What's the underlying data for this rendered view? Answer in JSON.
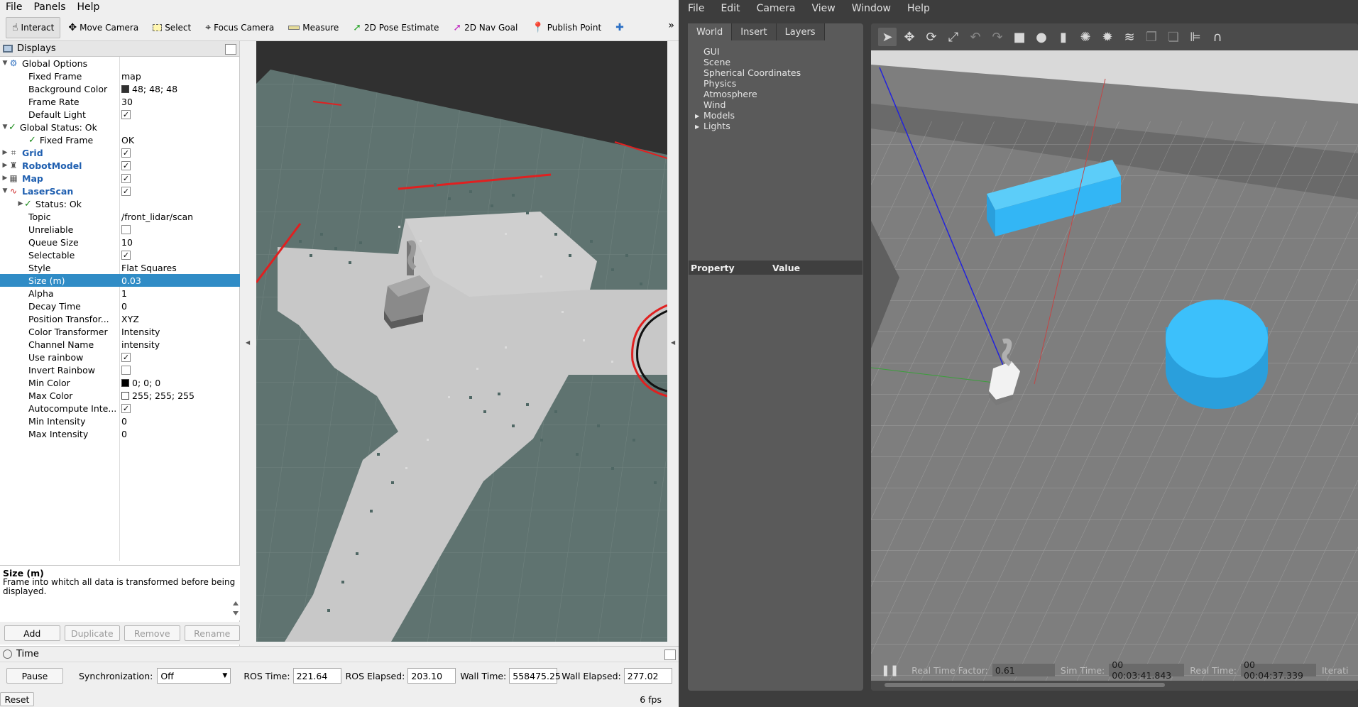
{
  "rviz": {
    "menu": [
      "File",
      "Panels",
      "Help"
    ],
    "tools": [
      {
        "label": "Interact",
        "icon": "interact-icon"
      },
      {
        "label": "Move Camera",
        "icon": "move-camera-icon"
      },
      {
        "label": "Select",
        "icon": "select-icon"
      },
      {
        "label": "Focus Camera",
        "icon": "focus-camera-icon"
      },
      {
        "label": "Measure",
        "icon": "measure-icon"
      },
      {
        "label": "2D Pose Estimate",
        "icon": "pose-estimate-icon"
      },
      {
        "label": "2D Nav Goal",
        "icon": "nav-goal-icon"
      },
      {
        "label": "Publish Point",
        "icon": "publish-point-icon"
      }
    ],
    "displays_title": "Displays",
    "tree": {
      "global_options": "Global Options",
      "fixed_frame_label": "Fixed Frame",
      "fixed_frame_value": "map",
      "background_color_label": "Background Color",
      "background_color_value": "48; 48; 48",
      "frame_rate_label": "Frame Rate",
      "frame_rate_value": "30",
      "default_light_label": "Default Light",
      "global_status": "Global Status: Ok",
      "fixed_frame_status_label": "Fixed Frame",
      "fixed_frame_status_value": "OK",
      "grid": "Grid",
      "robot_model": "RobotModel",
      "map": "Map",
      "laser_scan": "LaserScan",
      "status_ok": "Status: Ok",
      "topic_label": "Topic",
      "topic_value": "/front_lidar/scan",
      "unreliable_label": "Unreliable",
      "queue_size_label": "Queue Size",
      "queue_size_value": "10",
      "selectable_label": "Selectable",
      "style_label": "Style",
      "style_value": "Flat Squares",
      "size_label": "Size (m)",
      "size_value": "0.03",
      "alpha_label": "Alpha",
      "alpha_value": "1",
      "decay_label": "Decay Time",
      "decay_value": "0",
      "position_transformer_label": "Position Transfor...",
      "position_transformer_value": "XYZ",
      "color_transformer_label": "Color Transformer",
      "color_transformer_value": "Intensity",
      "channel_name_label": "Channel Name",
      "channel_name_value": "intensity",
      "use_rainbow_label": "Use rainbow",
      "invert_rainbow_label": "Invert Rainbow",
      "min_color_label": "Min Color",
      "min_color_value": "0; 0; 0",
      "max_color_label": "Max Color",
      "max_color_value": "255; 255; 255",
      "autocompute_label": "Autocompute Inte...",
      "min_intensity_label": "Min Intensity",
      "min_intensity_value": "0",
      "max_intensity_label": "Max Intensity",
      "max_intensity_value": "0"
    },
    "help": {
      "title": "Size (m)",
      "text": "Frame into whitch all data is transformed before being displayed."
    },
    "buttons": {
      "add": "Add",
      "duplicate": "Duplicate",
      "remove": "Remove",
      "rename": "Rename"
    },
    "time": {
      "title": "Time",
      "pause": "Pause",
      "sync_label": "Synchronization:",
      "sync_value": "Off",
      "ros_time_label": "ROS Time:",
      "ros_time": "221.64",
      "ros_elapsed_label": "ROS Elapsed:",
      "ros_elapsed": "203.10",
      "wall_time_label": "Wall Time:",
      "wall_time": "558475.25",
      "wall_elapsed_label": "Wall Elapsed:",
      "wall_elapsed": "277.02"
    },
    "reset": "Reset",
    "fps": "6 fps"
  },
  "gazebo": {
    "menu": [
      "File",
      "Edit",
      "Camera",
      "View",
      "Window",
      "Help"
    ],
    "tabs": [
      "World",
      "Insert",
      "Layers"
    ],
    "world_tree": [
      "GUI",
      "Scene",
      "Spherical Coordinates",
      "Physics",
      "Atmosphere",
      "Wind",
      "Models",
      "Lights"
    ],
    "property_header": "Property",
    "value_header": "Value",
    "status": {
      "rtf_label": "Real Time Factor:",
      "rtf": "0.61",
      "sim_time_label": "Sim Time:",
      "sim_time": "00 00:03:41.843",
      "real_time_label": "Real Time:",
      "real_time": "00 00:04:37.339",
      "iterations_label": "Iterati"
    }
  },
  "colors": {
    "rviz_bg": "#303030",
    "map_occupied": "#5f7370",
    "map_free": "#c8c8c8",
    "selection": "#308cc6",
    "gazebo_object": "#33b6f5"
  }
}
